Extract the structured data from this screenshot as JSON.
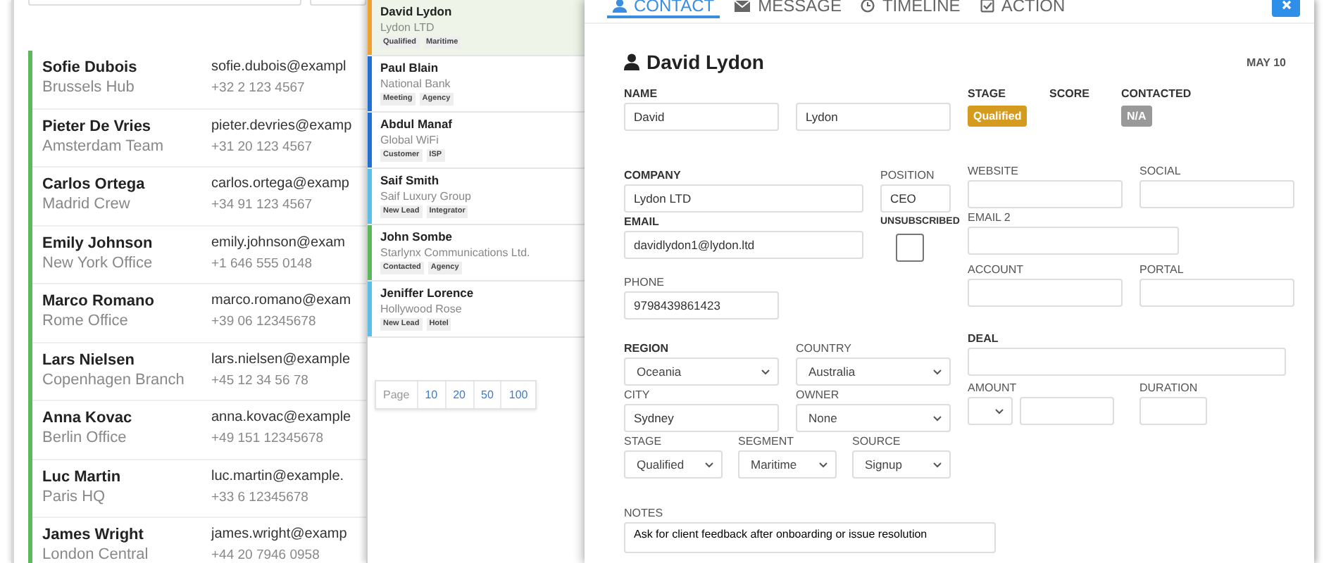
{
  "contact_list": {
    "contacts": [
      {
        "name": "Sofie Dubois",
        "team": "Brussels Hub",
        "email": "sofie.dubois@exampl",
        "phone": "+32 2 123 4567"
      },
      {
        "name": "Pieter De Vries",
        "team": "Amsterdam Team",
        "email": "pieter.devries@examp",
        "phone": "+31 20 123 4567"
      },
      {
        "name": "Carlos Ortega",
        "team": "Madrid Crew",
        "email": "carlos.ortega@examp",
        "phone": "+34 91 123 4567"
      },
      {
        "name": "Emily Johnson",
        "team": "New York Office",
        "email": "emily.johnson@exam",
        "phone": "+1 646 555 0148"
      },
      {
        "name": "Marco Romano",
        "team": "Rome Office",
        "email": "marco.romano@exam",
        "phone": "+39 06 12345678"
      },
      {
        "name": "Lars Nielsen",
        "team": "Copenhagen Branch",
        "email": "lars.nielsen@example",
        "phone": "+45 12 34 56 78"
      },
      {
        "name": "Anna Kovac",
        "team": "Berlin Office",
        "email": "anna.kovac@example",
        "phone": "+49 151 12345678"
      },
      {
        "name": "Luc Martin",
        "team": "Paris HQ",
        "email": "luc.martin@example.",
        "phone": "+33 6 12345678"
      },
      {
        "name": "James Wright",
        "team": "London Central",
        "email": "james.wright@examp",
        "phone": "+44 20 7946 0958"
      }
    ]
  },
  "lead_list": {
    "items": [
      {
        "name": "David Lydon",
        "company": "Lydon LTD",
        "tags": [
          "Qualified",
          "Maritime"
        ],
        "color": "#f0a030",
        "selected": true
      },
      {
        "name": "Paul Blain",
        "company": "National Bank",
        "tags": [
          "Meeting",
          "Agency"
        ],
        "color": "#1f6fd6",
        "selected": false
      },
      {
        "name": "Abdul Manaf",
        "company": "Global WiFi",
        "tags": [
          "Customer",
          "ISP"
        ],
        "color": "#1f6fd6",
        "selected": false
      },
      {
        "name": "Saif Smith",
        "company": "Saif Luxury Group",
        "tags": [
          "New Lead",
          "Integrator"
        ],
        "color": "#5bc0e8",
        "selected": false
      },
      {
        "name": "John Sombe",
        "company": "Starlynx Communications Ltd.",
        "tags": [
          "Contacted",
          "Agency"
        ],
        "color": "#5cb85c",
        "selected": false
      },
      {
        "name": "Jeniffer Lorence",
        "company": "Hollywood Rose",
        "tags": [
          "New Lead",
          "Hotel"
        ],
        "color": "#5bc0e8",
        "selected": false
      }
    ],
    "pager": {
      "label": "Page",
      "sizes": [
        "10",
        "20",
        "50",
        "100"
      ]
    }
  },
  "detail": {
    "tabs": [
      {
        "label": "CONTACT",
        "selected": true
      },
      {
        "label": "MESSAGE",
        "selected": false
      },
      {
        "label": "TIMELINE",
        "selected": false
      },
      {
        "label": "ACTION",
        "selected": false
      }
    ],
    "title": "David Lydon",
    "date": "MAY 10",
    "name": {
      "label": "NAME",
      "first": "David",
      "last": "Lydon"
    },
    "company": {
      "label": "COMPANY",
      "value": "Lydon LTD"
    },
    "position": {
      "label": "POSITION",
      "value": "CEO"
    },
    "email": {
      "label": "EMAIL",
      "value": "davidlydon1@lydon.ltd"
    },
    "unsubscribed": {
      "label": "UNSUBSCRIBED",
      "checked": false
    },
    "phone": {
      "label": "PHONE",
      "value": "9798439861423"
    },
    "region": {
      "label": "REGION",
      "value": "Oceania"
    },
    "country": {
      "label": "COUNTRY",
      "value": "Australia"
    },
    "city": {
      "label": "CITY",
      "value": "Sydney"
    },
    "owner": {
      "label": "OWNER",
      "value": "None"
    },
    "stage": {
      "label": "STAGE",
      "value": "Qualified"
    },
    "segment": {
      "label": "SEGMENT",
      "value": "Maritime"
    },
    "source": {
      "label": "SOURCE",
      "value": "Signup"
    },
    "notes": {
      "label": "NOTES",
      "value": "Ask for client feedback after onboarding or issue resolution"
    },
    "stage_badge": {
      "label": "STAGE",
      "value": "Qualified"
    },
    "score": {
      "label": "SCORE"
    },
    "contacted": {
      "label": "CONTACTED",
      "value": "N/A"
    },
    "website": {
      "label": "WEBSITE"
    },
    "social": {
      "label": "SOCIAL"
    },
    "email2": {
      "label": "EMAIL 2"
    },
    "account": {
      "label": "ACCOUNT"
    },
    "portal": {
      "label": "PORTAL"
    },
    "deal": {
      "label": "DEAL"
    },
    "amount": {
      "label": "AMOUNT"
    },
    "duration": {
      "label": "DURATION"
    }
  }
}
